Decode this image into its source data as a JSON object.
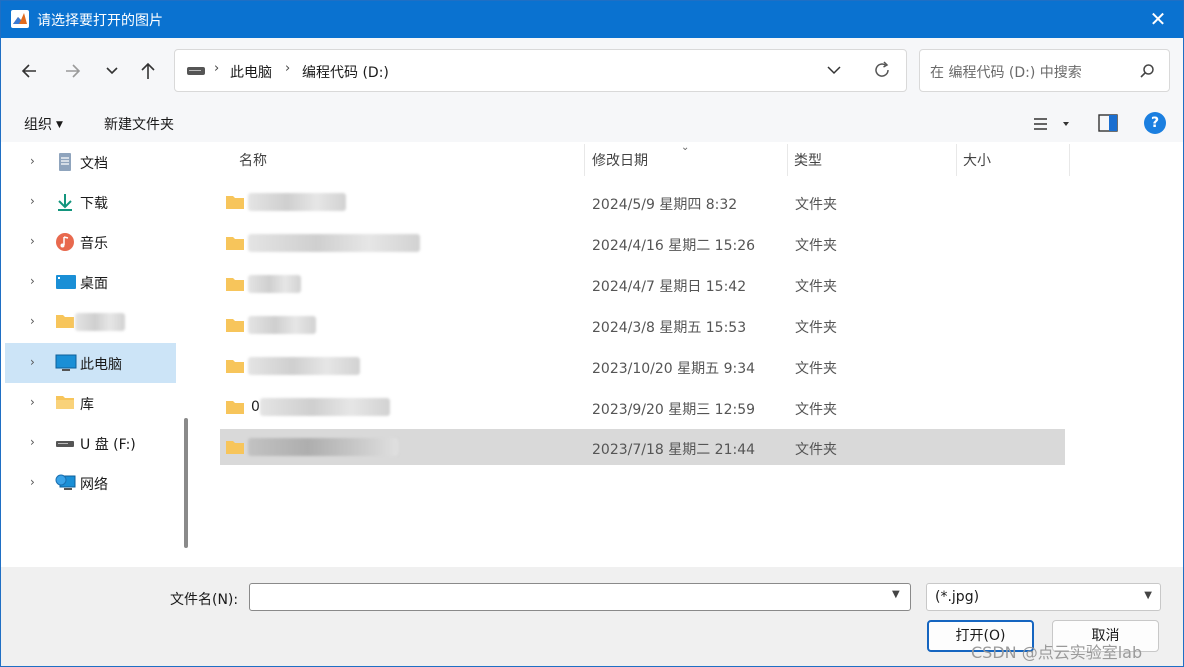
{
  "window": {
    "title": "请选择要打开的图片"
  },
  "nav": {
    "breadcrumb": [
      "此电脑",
      "编程代码 (D:)"
    ],
    "search_placeholder": "在 编程代码 (D:) 中搜索"
  },
  "toolbar": {
    "organize_label": "组织",
    "new_folder_label": "新建文件夹"
  },
  "sidebar": {
    "items": [
      {
        "label": "文档",
        "icon": "document-icon"
      },
      {
        "label": "下载",
        "icon": "download-icon"
      },
      {
        "label": "音乐",
        "icon": "music-icon"
      },
      {
        "label": "桌面",
        "icon": "desktop-icon"
      },
      {
        "label": "",
        "icon": "folder-icon"
      },
      {
        "label": "此电脑",
        "icon": "computer-icon",
        "selected": true
      },
      {
        "label": "库",
        "icon": "library-icon"
      },
      {
        "label": "U 盘 (F:)",
        "icon": "usb-drive-icon"
      },
      {
        "label": "网络",
        "icon": "network-icon"
      }
    ]
  },
  "files": {
    "columns": [
      "名称",
      "修改日期",
      "类型",
      "大小"
    ],
    "rows": [
      {
        "name_prefix": "",
        "modified": "2024/5/9 星期四 8:32",
        "type": "文件夹"
      },
      {
        "name_prefix": "",
        "modified": "2024/4/16 星期二 15:26",
        "type": "文件夹"
      },
      {
        "name_prefix": "",
        "modified": "2024/4/7 星期日 15:42",
        "type": "文件夹"
      },
      {
        "name_prefix": "",
        "modified": "2024/3/8 星期五 15:53",
        "type": "文件夹"
      },
      {
        "name_prefix": "",
        "modified": "2023/10/20 星期五 9:34",
        "type": "文件夹"
      },
      {
        "name_prefix": "0",
        "modified": "2023/9/20 星期三 12:59",
        "type": "文件夹"
      },
      {
        "name_prefix": "",
        "modified": "2023/7/18 星期二 21:44",
        "type": "文件夹",
        "selected": true
      }
    ]
  },
  "bottom": {
    "filename_label": "文件名(N):",
    "filename_value": "",
    "filter_value": "(*.jpg)",
    "open_label": "打开(O)",
    "cancel_label": "取消",
    "watermark": "CSDN @点云实验室lab"
  },
  "colors": {
    "titlebar": "#0a72d0",
    "selection_sidebar": "#cce4f7",
    "selection_row": "#d9d9d9",
    "folder": "#f7c55b",
    "help": "#1b7fe0"
  }
}
